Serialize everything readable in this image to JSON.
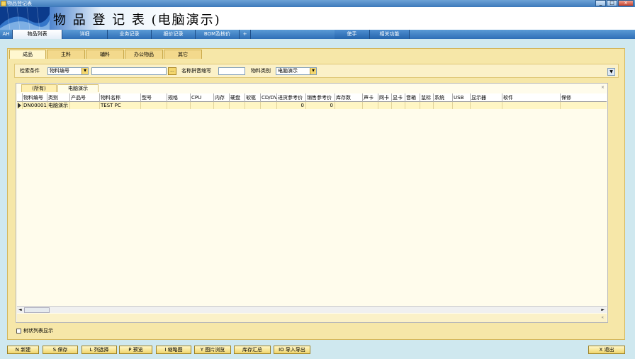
{
  "window": {
    "title": "物品登记表"
  },
  "banner": {
    "title": "物 品 登 记 表 (电脑演示)"
  },
  "menu": {
    "items": [
      "AH",
      "物品列表",
      "详细",
      "业务记录",
      "报价记录",
      "BOM及核价",
      "+"
    ],
    "right_items": [
      "使手",
      "相关功能"
    ]
  },
  "main_tabs": [
    "成品",
    "主料",
    "辅料",
    "办公物品",
    "其它"
  ],
  "filter": {
    "condition_label": "检索条件",
    "condition_value": "物料编号",
    "search_value": "",
    "pinyin_label": "名称拼音缩写",
    "pinyin_value": "",
    "category_label": "物料类别",
    "category_value": "电脑演示"
  },
  "grid_tabs": [
    "(所有)",
    "电脑演示"
  ],
  "grid": {
    "columns": [
      "物料编号",
      "类别",
      "产品号",
      "物料名称",
      "型号",
      "规格",
      "CPU",
      "内存",
      "硬盘",
      "软驱",
      "CD/DVD",
      "进货参考价",
      "销售参考价",
      "库存数",
      "声卡",
      "网卡",
      "显卡",
      "音箱",
      "鼠标",
      "系统",
      "USB",
      "显示器",
      "软件",
      "保修"
    ],
    "rows": [
      [
        "DN00001",
        "电脑演示",
        "",
        "TEST PC",
        "",
        "",
        "",
        "",
        "",
        "",
        "",
        "0",
        "0",
        "",
        "",
        "",
        "",
        "",
        "",
        "",
        "",
        "",
        "",
        ""
      ]
    ]
  },
  "tree_checkbox_label": "树状列表显示",
  "toolbar": {
    "new": "N 新建",
    "save": "S 保存",
    "select": "L 列选择",
    "preview": "P 预览",
    "thumbnail": "I 缩略图",
    "image_view": "Y 图片浏览",
    "stock_summary": "库存汇总",
    "import_export": "IO 导入导出",
    "exit": "X 退出"
  }
}
